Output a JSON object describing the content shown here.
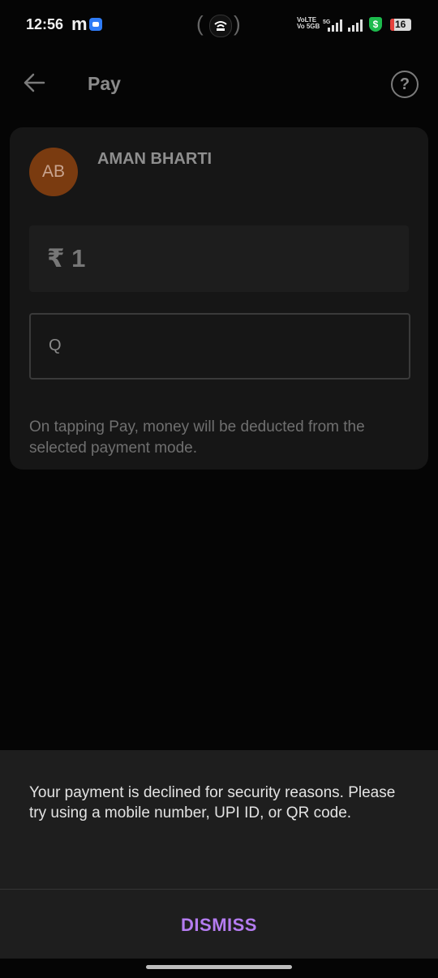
{
  "status": {
    "time": "12:56",
    "m_label": "m",
    "net_top": "VoLTE",
    "net_bottom": "Vo 5GB",
    "net_5g": "5G",
    "shield": "$",
    "battery": "16"
  },
  "appbar": {
    "title": "Pay",
    "back_icon": "arrow-left-icon",
    "help_icon": "question-circle-icon",
    "help_glyph": "?"
  },
  "payee": {
    "initials": "AB",
    "name": "AMAN BHARTI",
    "avatar_color": "#7a3b10"
  },
  "payment": {
    "amount": "₹ 1",
    "note_value": "Q",
    "info_text": "On tapping Pay, money will be deducted from the selected payment mode."
  },
  "dialog": {
    "message": "Your payment is declined for security reasons. Please try using a mobile number, UPI ID, or QR code.",
    "dismiss_label": "DISMISS",
    "accent_color": "#b47cf0"
  }
}
